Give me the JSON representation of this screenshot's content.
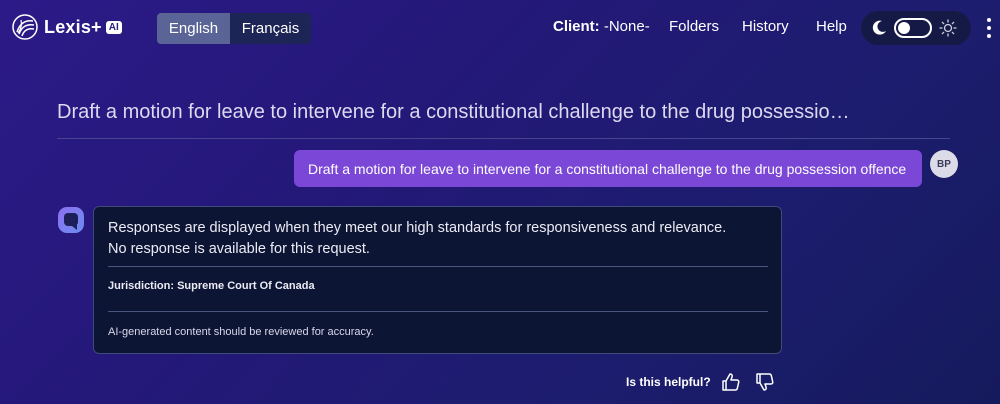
{
  "header": {
    "logo_text": "Lexis+",
    "logo_badge": "AI",
    "languages": [
      {
        "label": "English",
        "active": true
      },
      {
        "label": "Français",
        "active": false
      }
    ],
    "client_label": "Client:",
    "client_value": "-None-",
    "nav": [
      "Folders",
      "History",
      "Help"
    ],
    "theme": "dark"
  },
  "conversation": {
    "title": "Draft a motion for leave to intervene for a constitutional challenge to the drug possessio…",
    "user_message": "Draft a motion for leave to intervene for a constitutional challenge to the drug possession offence",
    "user_initials": "BP",
    "response": {
      "text": "Responses are displayed when they meet our high standards for responsiveness and relevance. No response is available for this request.",
      "jurisdiction_label": "Jurisdiction:",
      "jurisdiction_value": "Supreme Court Of Canada",
      "disclaimer": "AI-generated content should be reviewed for accuracy."
    },
    "feedback_label": "Is this helpful?"
  },
  "colors": {
    "accent_purple": "#7a47d6",
    "card_bg": "#0d1535",
    "toggle_active": "#5a6496"
  }
}
